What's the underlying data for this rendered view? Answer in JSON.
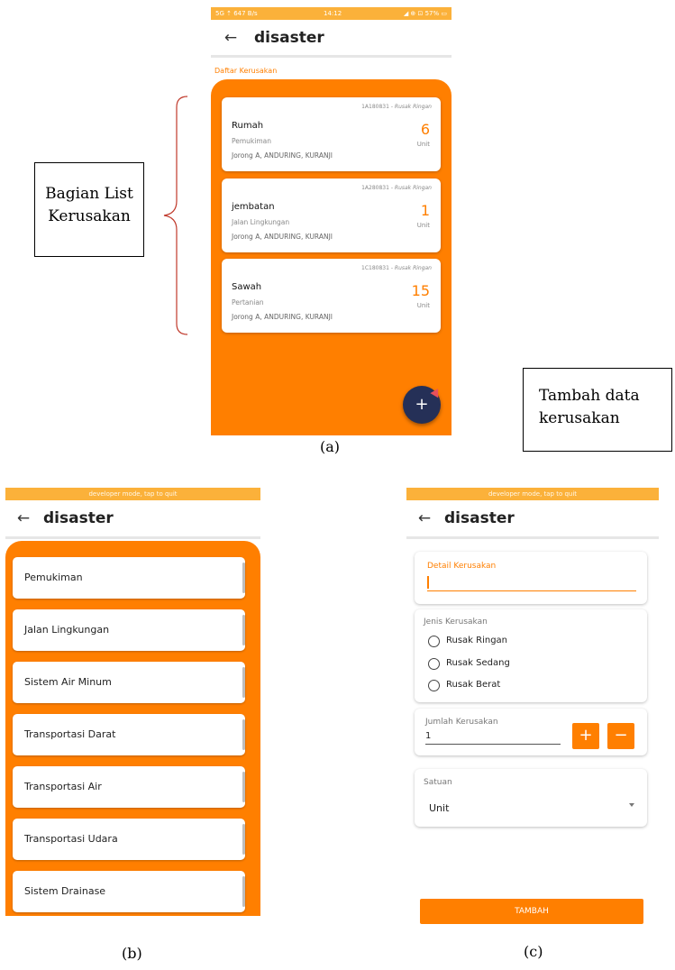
{
  "colors": {
    "accent": "#ff7f00",
    "fab": "#253057",
    "status_bar": "#fbb13a"
  },
  "screen_a": {
    "status": {
      "left": "5G ⇡ 647 B/s",
      "time": "14:12",
      "right": "◢ ⊕ ⊡ 57% ▭"
    },
    "appbar": {
      "title": "disaster"
    },
    "section_title": "Daftar Kerusakan",
    "items": [
      {
        "code": "1A180831 - ",
        "severity": "Rusak Ringan",
        "name": "Rumah",
        "category": "Pemukiman",
        "location": "Jorong A, ANDURING, KURANJI",
        "qty": "6",
        "unit": "Unit"
      },
      {
        "code": "1A280831 - ",
        "severity": "Rusak Ringan",
        "name": "jembatan",
        "category": "Jalan Lingkungan",
        "location": "Jorong A, ANDURING, KURANJI",
        "qty": "1",
        "unit": "Unit"
      },
      {
        "code": "1C180831 - ",
        "severity": "Rusak Ringan",
        "name": "Sawah",
        "category": "Pertanian",
        "location": "Jorong A, ANDURING, KURANJI",
        "qty": "15",
        "unit": "Unit"
      }
    ],
    "fab": "+",
    "caption": "(a)"
  },
  "annotations": {
    "list_label": [
      "Bagian List",
      "Kerusakan"
    ],
    "add_label": [
      "Tambah data",
      "kerusakan"
    ]
  },
  "screen_b": {
    "status": "developer mode, tap to quit",
    "appbar": {
      "title": "disaster"
    },
    "categories": [
      "Pemukiman",
      "Jalan Lingkungan",
      "Sistem Air Minum",
      "Transportasi Darat",
      "Transportasi Air",
      "Transportasi Udara",
      "Sistem Drainase"
    ],
    "caption": "(b)"
  },
  "screen_c": {
    "status": "developer mode, tap to quit",
    "appbar": {
      "title": "disaster"
    },
    "detail_label": "Detail Kerusakan",
    "detail_value": "",
    "jenis_label": "Jenis Kerusakan",
    "jenis_options": [
      "Rusak Ringan",
      "Rusak Sedang",
      "Rusak Berat"
    ],
    "jumlah_label": "Jumlah Kerusakan",
    "jumlah_value": "1",
    "plus": "+",
    "minus": "−",
    "satuan_label": "Satuan",
    "satuan_value": "Unit",
    "submit": "TAMBAH",
    "caption": "(c)"
  }
}
